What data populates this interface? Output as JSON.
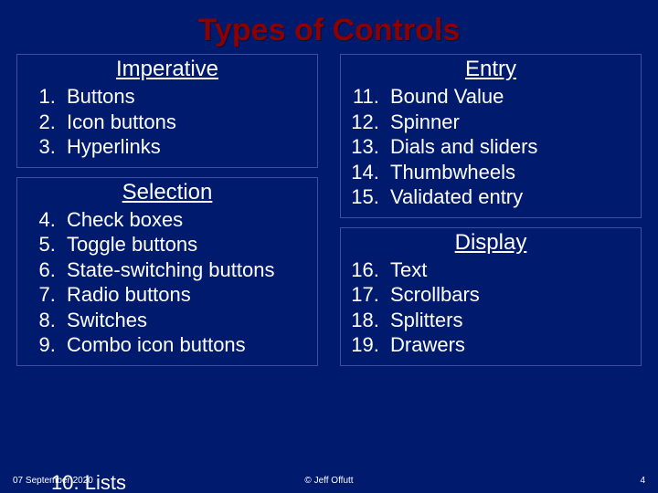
{
  "title": "Types of Controls",
  "left": {
    "imperative": {
      "heading": "Imperative",
      "start": 1,
      "items": [
        "Buttons",
        "Icon buttons",
        "Hyperlinks"
      ]
    },
    "selection": {
      "heading": "Selection",
      "start": 4,
      "items": [
        "Check boxes",
        "Toggle buttons",
        "State-switching buttons",
        "Radio buttons",
        "Switches",
        "Combo icon buttons"
      ]
    },
    "overflow": {
      "number": "10.",
      "text": "Lists"
    }
  },
  "right": {
    "entry": {
      "heading": "Entry",
      "start": 11,
      "items": [
        "Bound Value",
        "Spinner",
        "Dials and sliders",
        "Thumbwheels",
        "Validated entry"
      ]
    },
    "display": {
      "heading": "Display",
      "start": 16,
      "items": [
        "Text",
        "Scrollbars",
        "Splitters",
        "Drawers"
      ]
    }
  },
  "footer": {
    "date": "07 September 2020",
    "center": "© Jeff Offutt",
    "page": "4"
  }
}
